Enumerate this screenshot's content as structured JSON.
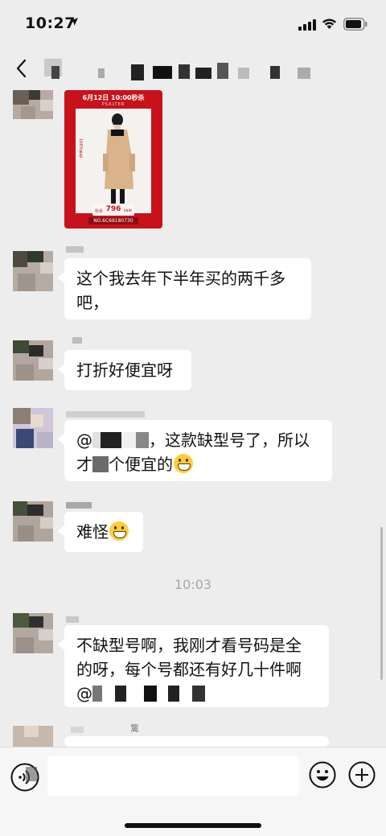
{
  "status_bar": {
    "time": "10:27"
  },
  "poster": {
    "header": "6月12日 10:00秒杀",
    "brand": "PSALTER",
    "side_text": "100%羊毛",
    "price_left": "秒杀",
    "price": "796",
    "price_right": "sale",
    "code": "NO.6C69180730"
  },
  "messages": [
    {
      "lines": [
        "这个我去年下半年买的两千多",
        "吧，"
      ]
    },
    {
      "lines": [
        "打折好便宜呀"
      ]
    },
    {
      "lines": [
        "@",
        "，这款缺型号了，所以",
        "才",
        "个便宜的"
      ],
      "emoji": "grinning-emoji"
    },
    {
      "lines": [
        "难怪"
      ],
      "emoji": "grinning-emoji"
    },
    {
      "lines": [
        "不缺型号啊，我刚才看号码是全",
        "的呀，每个号都还有好几十件啊",
        "@"
      ]
    }
  ],
  "timestamp": "10:03",
  "input": {
    "placeholder": ""
  },
  "partial_name": "篱"
}
